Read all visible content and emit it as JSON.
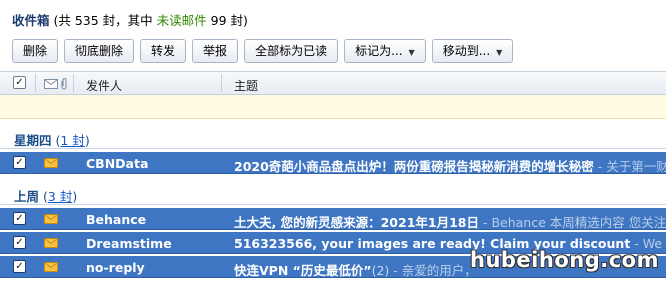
{
  "title_bar": {
    "box_name": "收件箱",
    "stat_prefix": " (共 535 封，其中 ",
    "unread_link": "未读邮件",
    "stat_suffix": " 99 封)"
  },
  "toolbar": {
    "delete": "删除",
    "delete_forever": "彻底删除",
    "forward": "转发",
    "report": "举报",
    "mark_all_read": "全部标为已读",
    "mark_as": "标记为...",
    "move_to": "移动到...",
    "caret": "▼"
  },
  "columns": {
    "sender": "发件人",
    "subject": "主题"
  },
  "groups": [
    {
      "name": "星期四",
      "count_open": " (",
      "count_link": "1 封",
      "count_close": ")",
      "rows": [
        {
          "sender": "CBNData",
          "subject": "2020奇葩小商品盘点出炉！两份重磅报告揭秘新消费的增长秘密",
          "thread": "",
          "preview": " - 关于第一财经"
        }
      ]
    },
    {
      "name": "上周",
      "count_open": " (",
      "count_link": "3 封",
      "count_close": ")",
      "rows": [
        {
          "sender": "Behance",
          "subject": "土大夫, 您的新灵感来源：2021年1月18日",
          "thread": "",
          "preview": " - Behance 本周精选内容 您关注的"
        },
        {
          "sender": "Dreamstime",
          "subject": "516323566, your images are ready! Claim your discount",
          "thread": "",
          "preview": " - We no"
        },
        {
          "sender": "no-reply",
          "subject": "快连VPN “历史最低价”",
          "thread": "(2)",
          "preview": " - 亲爱的用户，"
        }
      ]
    }
  ],
  "watermark": "hubeihong.com",
  "colors": {
    "row_selected": "#3f76c3",
    "notice_strip": "#fffbe1",
    "group_title": "#1c4f8a",
    "unread_link": "#2e8a00"
  },
  "icons": {
    "checkbox": "checkmark-icon",
    "envelope": "envelope-icon",
    "attachment": "paperclip-icon"
  }
}
